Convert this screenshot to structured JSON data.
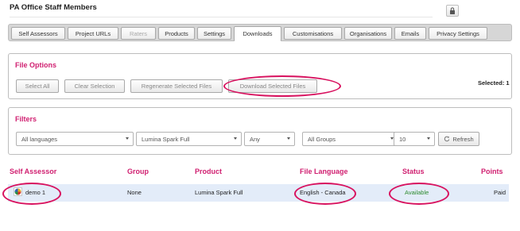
{
  "page": {
    "title": "PA Office Staff Members"
  },
  "tabs": [
    {
      "label": "Self Assessors"
    },
    {
      "label": "Project URLs"
    },
    {
      "label": "Raters"
    },
    {
      "label": "Products"
    },
    {
      "label": "Settings"
    },
    {
      "label": "Downloads"
    },
    {
      "label": "Customisations"
    },
    {
      "label": "Organisations"
    },
    {
      "label": "Emails"
    },
    {
      "label": "Privacy Settings"
    }
  ],
  "active_tab": "Downloads",
  "disabled_tab": "Raters",
  "file_options": {
    "title": "File Options",
    "buttons": [
      "Select All",
      "Clear Selection",
      "Regenerate Selected Files",
      "Download Selected Files"
    ],
    "selected_label": "Selected: 1"
  },
  "filters": {
    "title": "Filters",
    "language": "All languages",
    "product": "Lumina Spark Full",
    "any": "Any",
    "group": "All Groups",
    "page_size": "10",
    "refresh_label": "Refresh"
  },
  "table": {
    "headers": [
      "Self Assessor",
      "Group",
      "Product",
      "File Language",
      "Status",
      "Points"
    ],
    "rows": [
      {
        "self_assessor": "demo 1",
        "group": "None",
        "product": "Lumina Spark Full",
        "file_language": "English - Canada",
        "status": "Available",
        "points": "Paid"
      }
    ]
  },
  "colors": {
    "accent": "#d01f70",
    "highlight": "#d8125f",
    "row_bg": "#e3ecf9",
    "status_available": "#2e8b2e"
  },
  "icons": [
    "lock-icon",
    "refresh-icon",
    "dropdown-caret-icon",
    "avatar-icon"
  ]
}
